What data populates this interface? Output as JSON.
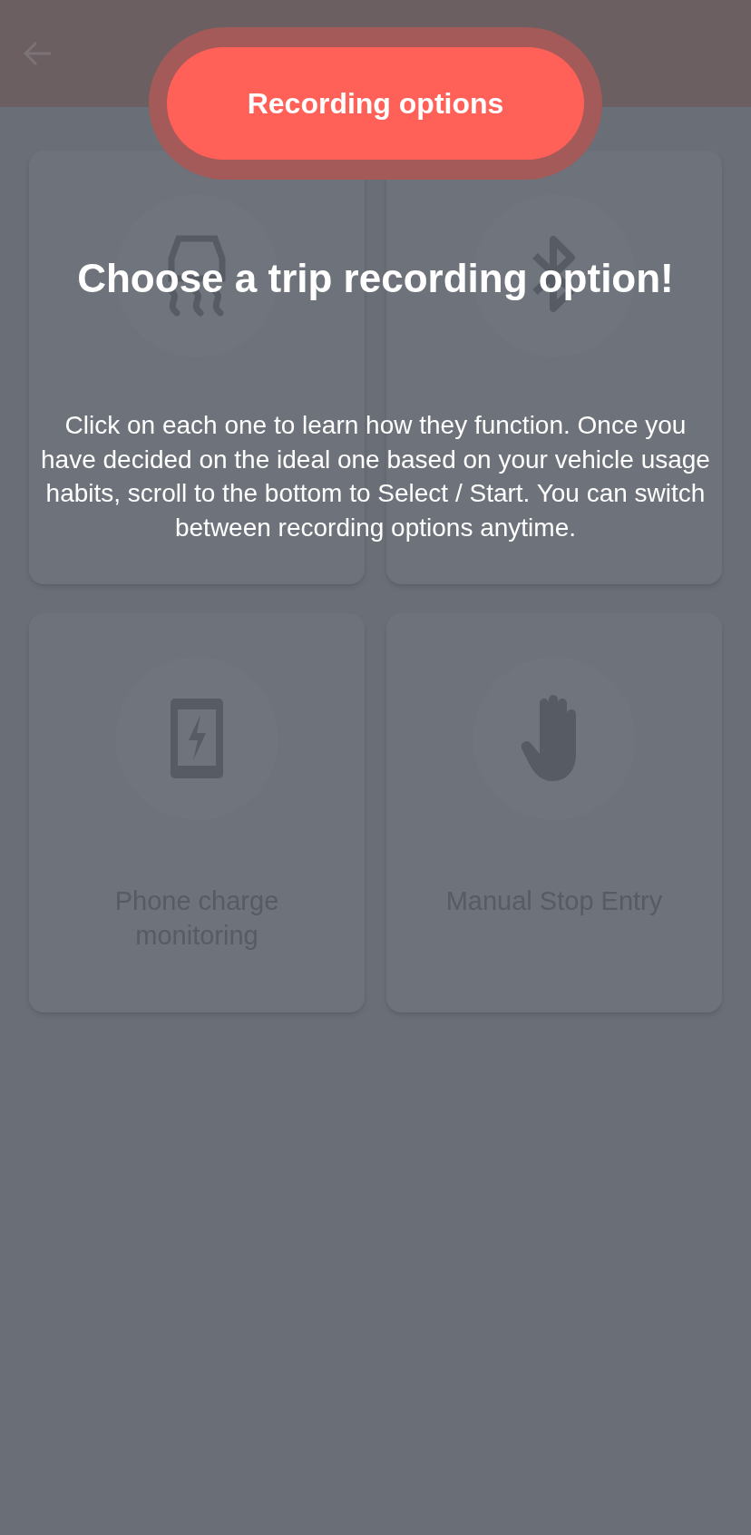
{
  "tour": {
    "button": "Recording options",
    "title": "Choose a trip recording option!",
    "body": "Click on each one to learn how they function. Once you have decided on the ideal one based on your vehicle usage habits, scroll to the bottom to Select / Start. You can switch between recording options anytime."
  },
  "options": [
    {
      "kind": "vehicle"
    },
    {
      "kind": "bluetooth"
    },
    {
      "kind": "charge",
      "label": "Phone charge monitoring"
    },
    {
      "kind": "manual",
      "label": "Manual Stop Entry"
    }
  ]
}
